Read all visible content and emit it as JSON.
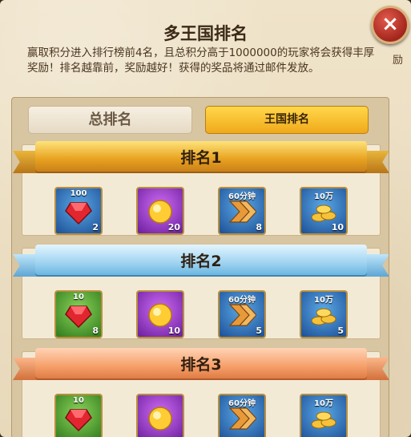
{
  "header": {
    "title": "多王国排名",
    "description": "赢取积分进入排行榜前4名，且总积分高于1000000的玩家将会获得丰厚奖励！排名越靠前，奖励越好！获得的奖品将通过邮件发放。",
    "close_label": "×",
    "edge_text": "励"
  },
  "tabs": [
    {
      "label": "总排名",
      "selected": true
    },
    {
      "label": "王国排名",
      "selected": false
    }
  ],
  "ranks": [
    {
      "label": "排名1",
      "color": "gold",
      "items": [
        {
          "icon": "ruby-icon",
          "top": "100",
          "count": "2",
          "bg": "blue"
        },
        {
          "icon": "golden-orb-icon",
          "top": "",
          "count": "20",
          "bg": "purple"
        },
        {
          "icon": "speedup-arrow-icon",
          "top": "60分钟",
          "count": "8",
          "bg": "blue"
        },
        {
          "icon": "gold-coins-icon",
          "top": "10万",
          "count": "10",
          "bg": "blue"
        }
      ]
    },
    {
      "label": "排名2",
      "color": "blue",
      "items": [
        {
          "icon": "ruby-icon",
          "top": "10",
          "count": "8",
          "bg": "green"
        },
        {
          "icon": "golden-orb-icon",
          "top": "",
          "count": "10",
          "bg": "purple"
        },
        {
          "icon": "speedup-arrow-icon",
          "top": "60分钟",
          "count": "5",
          "bg": "blue"
        },
        {
          "icon": "gold-coins-icon",
          "top": "10万",
          "count": "5",
          "bg": "blue"
        }
      ]
    },
    {
      "label": "排名3",
      "color": "orange",
      "items": [
        {
          "icon": "ruby-icon",
          "top": "10",
          "count": "",
          "bg": "green"
        },
        {
          "icon": "golden-orb-icon",
          "top": "",
          "count": "",
          "bg": "purple"
        },
        {
          "icon": "speedup-arrow-icon",
          "top": "60分钟",
          "count": "",
          "bg": "blue"
        },
        {
          "icon": "gold-coins-icon",
          "top": "10万",
          "count": "",
          "bg": "blue"
        }
      ]
    }
  ]
}
